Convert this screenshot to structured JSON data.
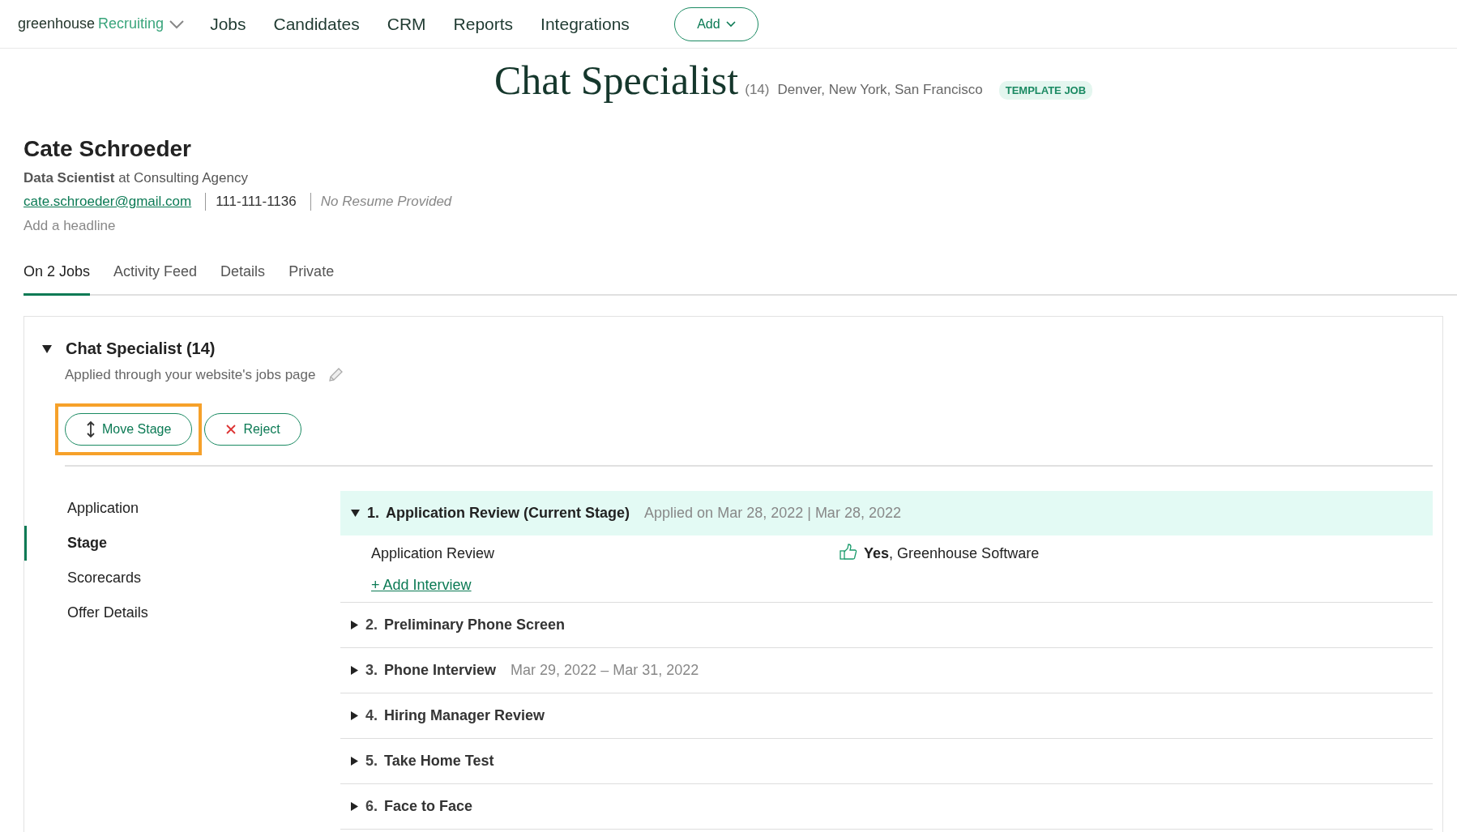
{
  "nav": {
    "logo_brand": "greenhouse",
    "logo_product": "Recruiting",
    "items": [
      "Jobs",
      "Candidates",
      "CRM",
      "Reports",
      "Integrations"
    ],
    "add_button": "Add"
  },
  "job_header": {
    "title": "Chat Specialist",
    "count": "(14)",
    "locations": "Denver, New York, San Francisco",
    "badge": "TEMPLATE JOB"
  },
  "candidate": {
    "name": "Cate Schroeder",
    "headline": "**Data Scientist** at Consulting Agency",
    "email": "cate.schroeder@gmail.com",
    "phone": "111-111-1136",
    "resume": "No Resume Provided",
    "add_headline": "Add a headline"
  },
  "tabs": [
    {
      "label": "On 2 Jobs",
      "selected": true
    },
    {
      "label": "Activity Feed",
      "selected": false
    },
    {
      "label": "Details",
      "selected": false
    },
    {
      "label": "Private",
      "selected": false
    }
  ],
  "job_card": {
    "title": "Chat Specialist (14)",
    "expanded": true,
    "source": "Applied through your website's jobs page",
    "actions": [
      {
        "kind": "move",
        "label": "Move Stage",
        "highlighted": true
      },
      {
        "kind": "reject",
        "label": "Reject",
        "highlighted": false
      }
    ],
    "side_nav": [
      {
        "label": "Application",
        "selected": false
      },
      {
        "label": "Stage",
        "selected": true
      },
      {
        "label": "Scorecards",
        "selected": false
      },
      {
        "label": "Offer Details",
        "selected": false
      }
    ],
    "stages": [
      {
        "number": "1.",
        "title": "Application Review (Current Stage)",
        "dates": "Applied on Mar 28, 2022 | Mar 28, 2022",
        "expanded": true,
        "current": true,
        "interviews": [
          {
            "name": "Application Review",
            "decision": "Yes",
            "reviewer": ", Greenhouse Software"
          }
        ],
        "add_link": "+ Add Interview"
      },
      {
        "number": "2.",
        "title": "Preliminary Phone Screen",
        "expanded": false,
        "current": false
      },
      {
        "number": "3.",
        "title": "Phone Interview",
        "dates": "Mar 29, 2022 – Mar 31, 2022",
        "expanded": false,
        "current": false
      },
      {
        "number": "4.",
        "title": "Hiring Manager Review",
        "expanded": false,
        "current": false
      },
      {
        "number": "5.",
        "title": "Take Home Test",
        "expanded": false,
        "current": false
      },
      {
        "number": "6.",
        "title": "Face to Face",
        "expanded": false,
        "current": false
      }
    ]
  }
}
